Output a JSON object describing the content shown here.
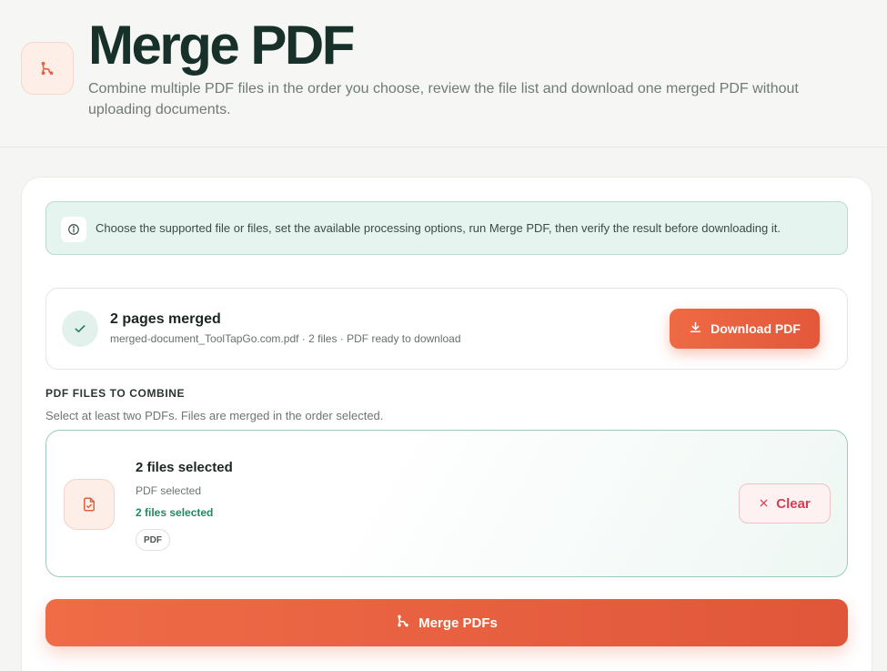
{
  "header": {
    "title": "Merge PDF",
    "subtitle": "Combine multiple PDF files in the order you choose, review the file list and download one merged PDF without uploading documents.",
    "icon": "merge-icon"
  },
  "notice": {
    "icon": "info-icon",
    "text": "Choose the supported file or files, set the available processing options, run Merge PDF, then verify the result before downloading it."
  },
  "result": {
    "icon": "check-icon",
    "title": "2 pages merged",
    "detail": "merged-document_ToolTapGo.com.pdf · 2 files · PDF ready to download",
    "download_label": "Download PDF",
    "download_icon": "download-icon"
  },
  "files_section": {
    "label": "PDF FILES TO COMBINE",
    "help": "Select at least two PDFs. Files are merged in the order selected.",
    "file_icon": "file-check-icon",
    "selected_title": "2 files selected",
    "selected_type": "PDF selected",
    "selected_count": "2 files selected",
    "format_chip": "PDF",
    "clear_label": "Clear",
    "clear_icon": "close-icon"
  },
  "merge_button": {
    "label": "Merge PDFs",
    "icon": "merge-icon"
  },
  "colors": {
    "accent": "#E9603F",
    "success": "#1F8A62",
    "danger": "#CF4056",
    "title": "#173029"
  }
}
